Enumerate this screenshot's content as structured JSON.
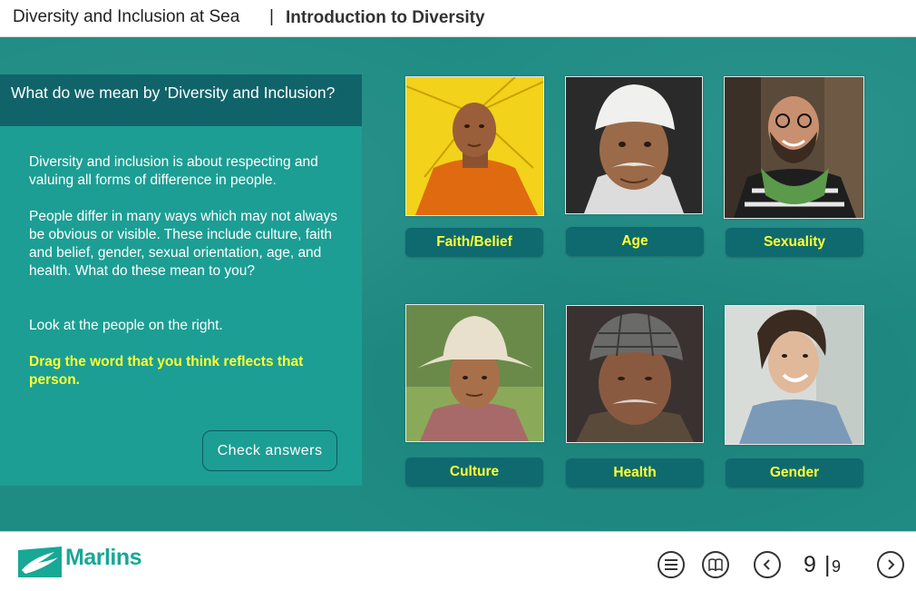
{
  "header": {
    "course_title": "Diversity and Inclusion at Sea",
    "separator": "|",
    "module_title": "Introduction to Diversity"
  },
  "question": {
    "title": "What do we mean by 'Diversity and Inclusion?",
    "paragraph_1": "Diversity and inclusion is about respecting and valuing all forms of difference in people.",
    "paragraph_2": "People differ in many ways which may not always be obvious or visible. These include culture, faith and belief, gender, sexual orientation, age, and health. What do these mean to you?",
    "paragraph_3": "Look at the people on the right.",
    "instruction": "Drag the word that you think reflects that person.",
    "check_button": "Check answers"
  },
  "labels": {
    "faith": "Faith/Belief",
    "age": "Age",
    "sexuality": "Sexuality",
    "culture": "Culture",
    "health": "Health",
    "gender": "Gender"
  },
  "footer": {
    "brand": "Marlins",
    "page_current": "9",
    "page_separator": "|",
    "page_total": "9"
  },
  "colors": {
    "stage_teal": "#1f8c84",
    "panel_header": "#11636a",
    "panel_body": "#1c9e94",
    "label_bg": "#0f6a6f",
    "highlight_text": "#ffff33",
    "brand": "#18a896"
  },
  "icons": [
    "menu-icon",
    "glossary-book-icon",
    "previous-arrow-icon",
    "next-arrow-icon",
    "marlins-logo-icon"
  ]
}
